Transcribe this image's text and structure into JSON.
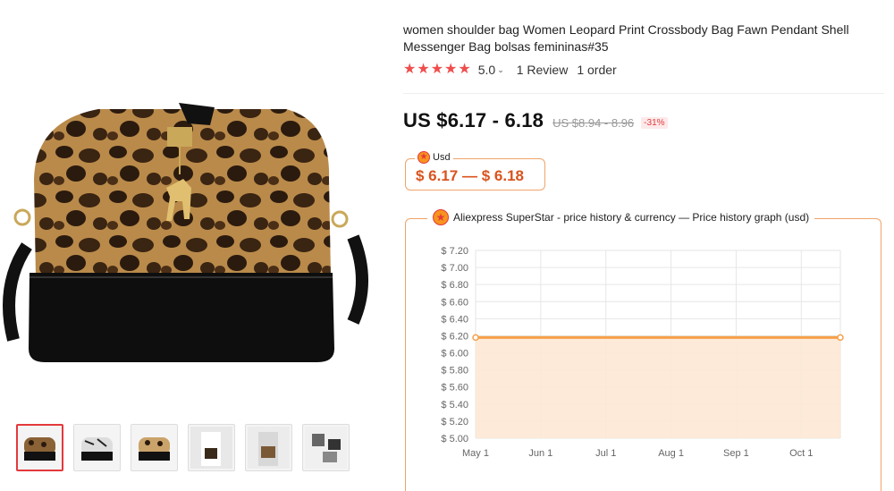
{
  "product": {
    "title": "women shoulder bag Women Leopard Print Crossbody Bag Fawn Pendant Shell Messenger Bag bolsas femininas#35",
    "rating_value": "5.0",
    "review_count": "1 Review",
    "orders": "1 order",
    "stars": 5,
    "price": "US $6.17 - 6.18",
    "old_price": "US $8.94 - 8.96",
    "discount": "-31%"
  },
  "currency_box": {
    "label": "Usd",
    "range": "$ 6.17 — $ 6.18"
  },
  "gallery": {
    "thumbnails": [
      "leopard-bag",
      "zebra-bag",
      "leopard-bag-2",
      "model-bag-1",
      "model-bag-2",
      "bag-variants"
    ]
  },
  "price_history": {
    "title": "Aliexpress SuperStar - price history & currency — Price history graph (usd)"
  },
  "colors": {
    "accent": "#f7941d",
    "price_red": "#e4393c",
    "line": "#f7a04a",
    "fill": "#fde8d4"
  },
  "chart_data": {
    "type": "area",
    "x": [
      "May 1",
      "Oct 1"
    ],
    "categories": [
      "May 1",
      "Jun 1",
      "Jul 1",
      "Aug 1",
      "Sep 1",
      "Oct 1"
    ],
    "series": [
      {
        "values": [
          6.18,
          6.18
        ]
      }
    ],
    "y_ticks": [
      "$ 7.20",
      "$ 7.00",
      "$ 6.80",
      "$ 6.60",
      "$ 6.40",
      "$ 6.20",
      "$ 6.00",
      "$ 5.80",
      "$ 5.60",
      "$ 5.40",
      "$ 5.20",
      "$ 5.00"
    ],
    "ylim": [
      5.0,
      7.2
    ],
    "grid": true
  }
}
